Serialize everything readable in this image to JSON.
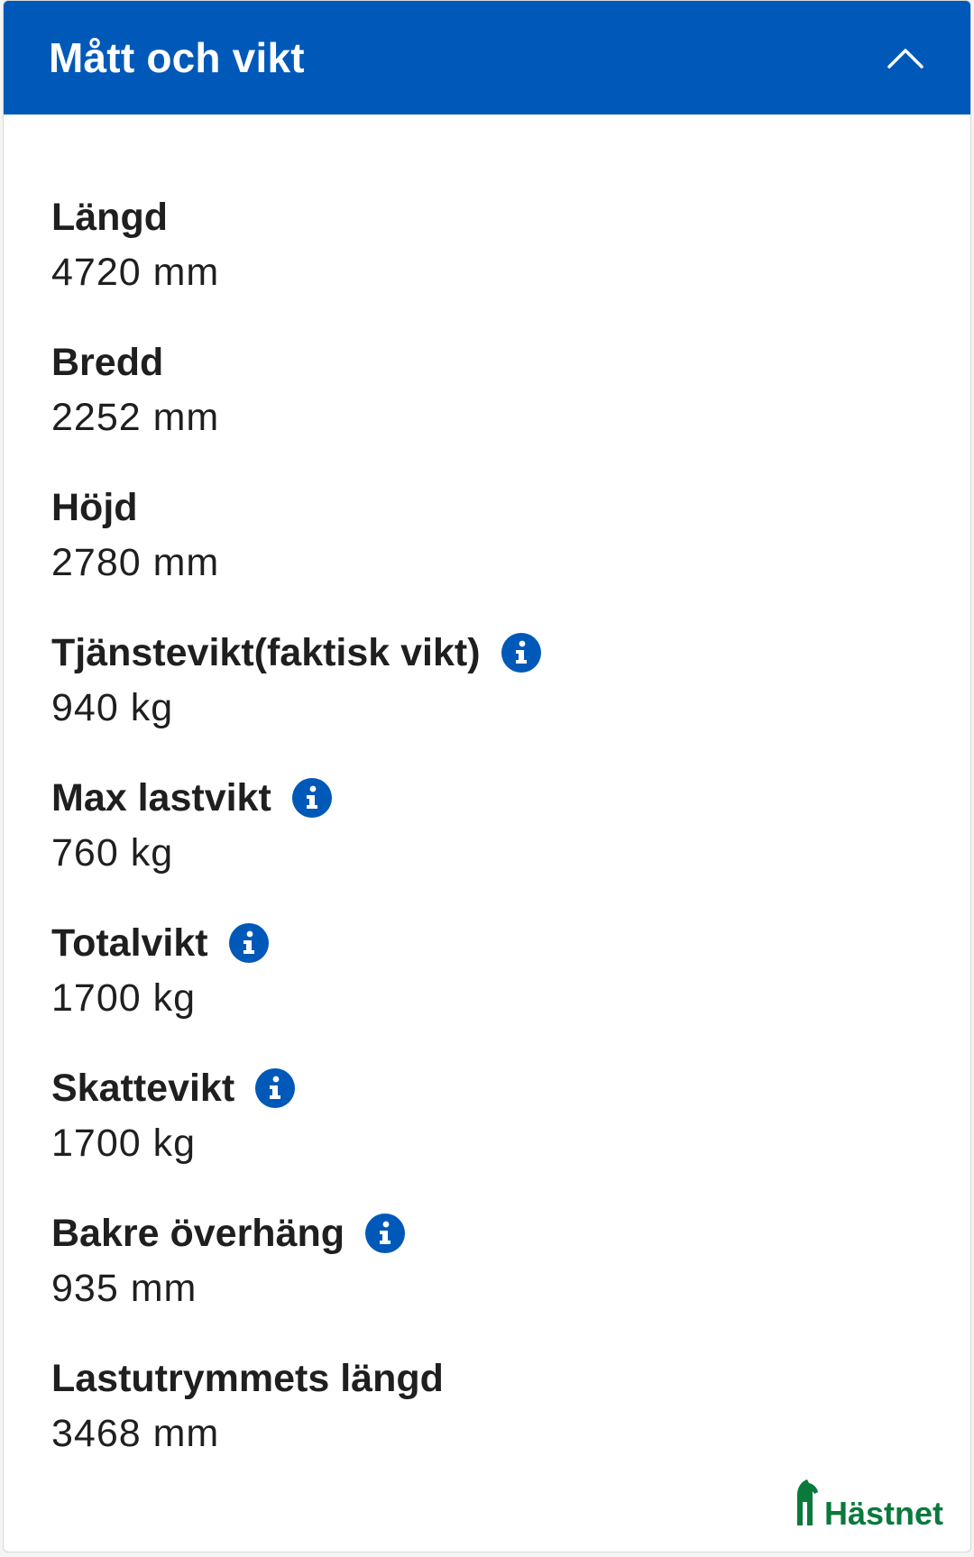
{
  "header": {
    "title": "Mått och vikt"
  },
  "specs": [
    {
      "label": "Längd",
      "value": "4720 mm",
      "info": false
    },
    {
      "label": "Bredd",
      "value": "2252 mm",
      "info": false
    },
    {
      "label": "Höjd",
      "value": "2780 mm",
      "info": false
    },
    {
      "label": "Tjänstevikt(faktisk vikt)",
      "value": "940 kg",
      "info": true
    },
    {
      "label": "Max lastvikt",
      "value": "760 kg",
      "info": true
    },
    {
      "label": "Totalvikt",
      "value": "1700 kg",
      "info": true
    },
    {
      "label": "Skattevikt",
      "value": "1700 kg",
      "info": true
    },
    {
      "label": "Bakre överhäng",
      "value": "935 mm",
      "info": true
    },
    {
      "label": "Lastutrymmets längd",
      "value": "3468 mm",
      "info": false
    }
  ],
  "logo": {
    "text": "Hästnet"
  },
  "colors": {
    "header_bg": "#0059b8",
    "info_icon": "#0059b8",
    "logo": "#0a7a3c"
  },
  "icons": {
    "header_toggle": "chevron-up-icon",
    "info": "info-icon"
  }
}
